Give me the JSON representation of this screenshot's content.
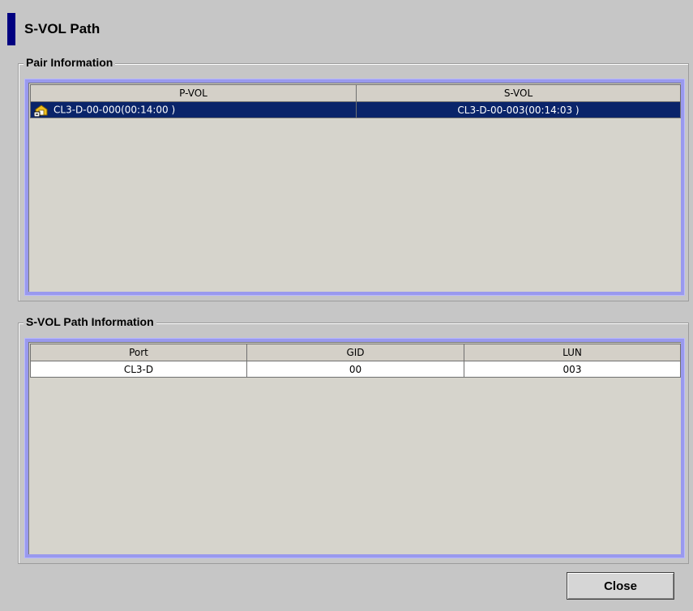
{
  "title": "S-VOL Path",
  "pair_information": {
    "legend": "Pair Information",
    "columns": [
      "P-VOL",
      "S-VOL"
    ],
    "rows": [
      {
        "pvol": "CL3-D-00-000(00:14:00 )",
        "svol": "CL3-D-00-003(00:14:03 )",
        "selected": true,
        "icon": "volume-pair-icon"
      }
    ]
  },
  "svol_path_information": {
    "legend": "S-VOL Path Information",
    "columns": [
      "Port",
      "GID",
      "LUN"
    ],
    "rows": [
      {
        "port": "CL3-D",
        "gid": "00",
        "lun": "003"
      }
    ]
  },
  "close_label": "Close",
  "colors": {
    "accent": "#000080",
    "selection": "#0a246a",
    "table_frame": "#9999ee",
    "panel_bg": "#c6c6c6"
  }
}
